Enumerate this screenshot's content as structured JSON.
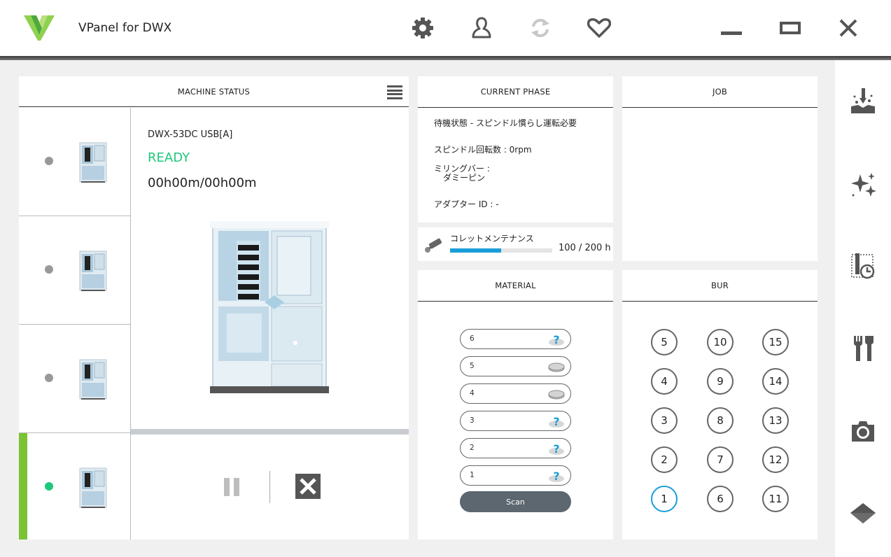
{
  "app": {
    "title": "VPanel for DWX"
  },
  "colors": {
    "ready": "#1ec87a",
    "active_bar": "#7bc234",
    "accent": "#1a9ed9",
    "scan_button": "#5c6770"
  },
  "toolbar": {
    "icons": [
      "gear-icon",
      "user-icon",
      "refresh-icon",
      "heart-icon"
    ]
  },
  "window_controls": [
    "minimize-icon",
    "maximize-icon",
    "close-icon"
  ],
  "machine_status": {
    "title": "MACHINE STATUS",
    "machines": [
      {
        "status": "idle"
      },
      {
        "status": "idle"
      },
      {
        "status": "idle"
      },
      {
        "status": "ready",
        "selected": true
      }
    ],
    "selected": {
      "model": "DWX-53DC USB[A]",
      "state": "READY",
      "time": "00h00m/00h00m"
    }
  },
  "current_phase": {
    "title": "CURRENT PHASE",
    "status": "待機状態 - スピンドル慣らし運転必要",
    "spindle": "スピンドル回転数 : 0rpm",
    "milling_bar_label": "ミリングバー :",
    "milling_bar_value": "ダミーピン",
    "adapter": "アダプター ID : -"
  },
  "collet": {
    "label": "コレットメンテナンス",
    "value": "100 / 200 h",
    "progress": 0.5
  },
  "job": {
    "title": "JOB"
  },
  "material": {
    "title": "MATERIAL",
    "slots": [
      {
        "label": "6",
        "icon": "question-icon"
      },
      {
        "label": "5",
        "icon": "disc-icon"
      },
      {
        "label": "4",
        "icon": "disc-icon"
      },
      {
        "label": "3",
        "icon": "question-icon"
      },
      {
        "label": "2",
        "icon": "question-icon"
      },
      {
        "label": "1",
        "icon": "question-icon"
      }
    ],
    "scan_label": "Scan"
  },
  "bur": {
    "title": "BUR",
    "rows": [
      [
        "5",
        "10",
        "15"
      ],
      [
        "4",
        "9",
        "14"
      ],
      [
        "3",
        "8",
        "13"
      ],
      [
        "2",
        "7",
        "12"
      ],
      [
        "1",
        "6",
        "11"
      ]
    ],
    "active": "1"
  },
  "sidebar": {
    "icons": [
      "milling-icon",
      "sparkle-icon",
      "bur-schedule-icon",
      "tools-icon",
      "camera-icon",
      "diamond-icon"
    ]
  }
}
